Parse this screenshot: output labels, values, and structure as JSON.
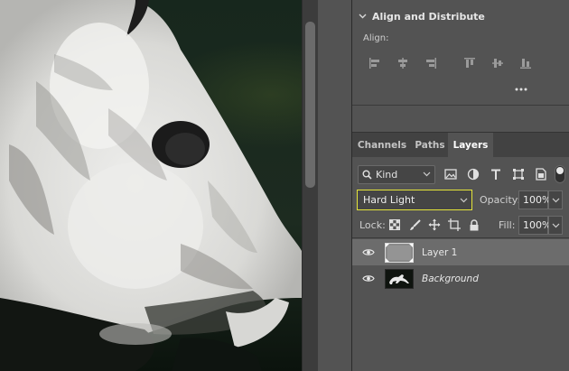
{
  "align_panel": {
    "title": "Align and Distribute",
    "align_label": "Align:",
    "icons": [
      "align-left-edges-icon",
      "align-horizontal-centers-icon",
      "align-right-edges-icon",
      "align-top-edges-icon",
      "align-vertical-centers-icon",
      "align-bottom-edges-icon",
      "more-options-icon"
    ]
  },
  "tabs": [
    {
      "label": "Channels",
      "active": false
    },
    {
      "label": "Paths",
      "active": false
    },
    {
      "label": "Layers",
      "active": true
    }
  ],
  "filter": {
    "kind_label": "Kind",
    "icons": [
      "pixel-layer-filter-icon",
      "adjustment-layer-filter-icon",
      "type-layer-filter-icon",
      "shape-layer-filter-icon",
      "smart-object-filter-icon",
      "filter-toggle-icon"
    ]
  },
  "blend_mode": "Hard Light",
  "opacity": {
    "label": "Opacity:",
    "value": "100%"
  },
  "lock": {
    "label": "Lock:",
    "icons": [
      "lock-transparent-pixels-icon",
      "lock-image-pixels-icon",
      "lock-position-icon",
      "lock-artboard-icon",
      "lock-all-icon"
    ]
  },
  "fill": {
    "label": "Fill:",
    "value": "100%"
  },
  "layers": [
    {
      "name": "Layer 1",
      "visible": true,
      "selected": true,
      "italic": false
    },
    {
      "name": "Background",
      "visible": true,
      "selected": false,
      "italic": true
    }
  ],
  "colors": {
    "panel_bg": "#535353",
    "tab_bar": "#424242",
    "selected_layer": "#6c6c6c",
    "blend_focus_border": "#e4e43a"
  }
}
